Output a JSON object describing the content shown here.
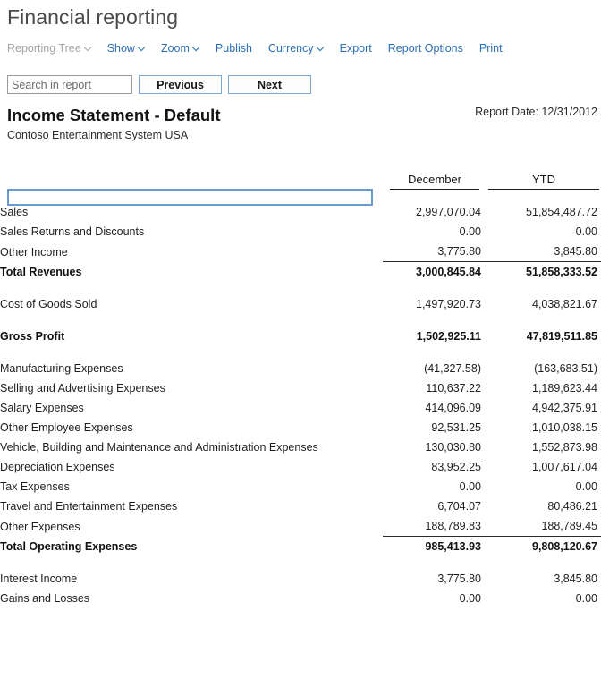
{
  "app": {
    "title": "Financial reporting"
  },
  "commandbar": {
    "items": [
      {
        "label": "Reporting Tree",
        "caret": true,
        "disabled": true,
        "name": "reporting-tree"
      },
      {
        "label": "Show",
        "caret": true,
        "disabled": false,
        "name": "show"
      },
      {
        "label": "Zoom",
        "caret": true,
        "disabled": false,
        "name": "zoom"
      },
      {
        "label": "Publish",
        "caret": false,
        "disabled": false,
        "name": "publish"
      },
      {
        "label": "Currency",
        "caret": true,
        "disabled": false,
        "name": "currency"
      },
      {
        "label": "Export",
        "caret": false,
        "disabled": false,
        "name": "export"
      },
      {
        "label": "Report Options",
        "caret": false,
        "disabled": false,
        "name": "report-options"
      },
      {
        "label": "Print",
        "caret": false,
        "disabled": false,
        "name": "print"
      }
    ]
  },
  "search": {
    "placeholder": "Search in report",
    "value": "",
    "previous_label": "Previous",
    "next_label": "Next"
  },
  "report": {
    "title": "Income Statement - Default",
    "subtitle": "Contoso Entertainment System USA",
    "date_label": "Report Date: 12/31/2012",
    "selected_row_value": ""
  },
  "table": {
    "columns": [
      "",
      "December",
      "YTD"
    ],
    "rows": [
      {
        "type": "spacer"
      },
      {
        "type": "row",
        "label": "Sales",
        "december": "2,997,070.04",
        "ytd": "51,854,487.72"
      },
      {
        "type": "row",
        "label": "Sales Returns and Discounts",
        "december": "0.00",
        "ytd": "0.00"
      },
      {
        "type": "ruled",
        "label": "Other Income",
        "december": "3,775.80",
        "ytd": "3,845.80"
      },
      {
        "type": "total",
        "label": "Total Revenues",
        "december": "3,000,845.84",
        "ytd": "51,858,333.52"
      },
      {
        "type": "spacer"
      },
      {
        "type": "row",
        "label": "Cost of Goods Sold",
        "december": "1,497,920.73",
        "ytd": "4,038,821.67"
      },
      {
        "type": "spacer"
      },
      {
        "type": "total",
        "label": "Gross Profit",
        "december": "1,502,925.11",
        "ytd": "47,819,511.85"
      },
      {
        "type": "spacer"
      },
      {
        "type": "row",
        "label": "Manufacturing Expenses",
        "december": "(41,327.58)",
        "ytd": "(163,683.51)"
      },
      {
        "type": "row",
        "label": "Selling and Advertising Expenses",
        "december": "110,637.22",
        "ytd": "1,189,623.44"
      },
      {
        "type": "row",
        "label": "Salary Expenses",
        "december": "414,096.09",
        "ytd": "4,942,375.91"
      },
      {
        "type": "row",
        "label": "Other Employee Expenses",
        "december": "92,531.25",
        "ytd": "1,010,038.15"
      },
      {
        "type": "row",
        "label": "Vehicle, Building and Maintenance and Administration Expenses",
        "december": "130,030.80",
        "ytd": "1,552,873.98"
      },
      {
        "type": "row",
        "label": "Depreciation Expenses",
        "december": "83,952.25",
        "ytd": "1,007,617.04"
      },
      {
        "type": "row",
        "label": "Tax Expenses",
        "december": "0.00",
        "ytd": "0.00"
      },
      {
        "type": "row",
        "label": "Travel and Entertainment Expenses",
        "december": "6,704.07",
        "ytd": "80,486.21"
      },
      {
        "type": "ruled",
        "label": "Other Expenses",
        "december": "188,789.83",
        "ytd": "188,789.45"
      },
      {
        "type": "total",
        "label": "Total Operating Expenses",
        "december": "985,413.93",
        "ytd": "9,808,120.67"
      },
      {
        "type": "spacer"
      },
      {
        "type": "row",
        "label": "Interest Income",
        "december": "3,775.80",
        "ytd": "3,845.80"
      },
      {
        "type": "row",
        "label": "Gains and Losses",
        "december": "0.00",
        "ytd": "0.00"
      }
    ]
  },
  "colors": {
    "link": "#2a6fb8",
    "disabled": "#a6a6a6",
    "accent_border": "#6a9bd1",
    "text": "#1f1f1f"
  }
}
